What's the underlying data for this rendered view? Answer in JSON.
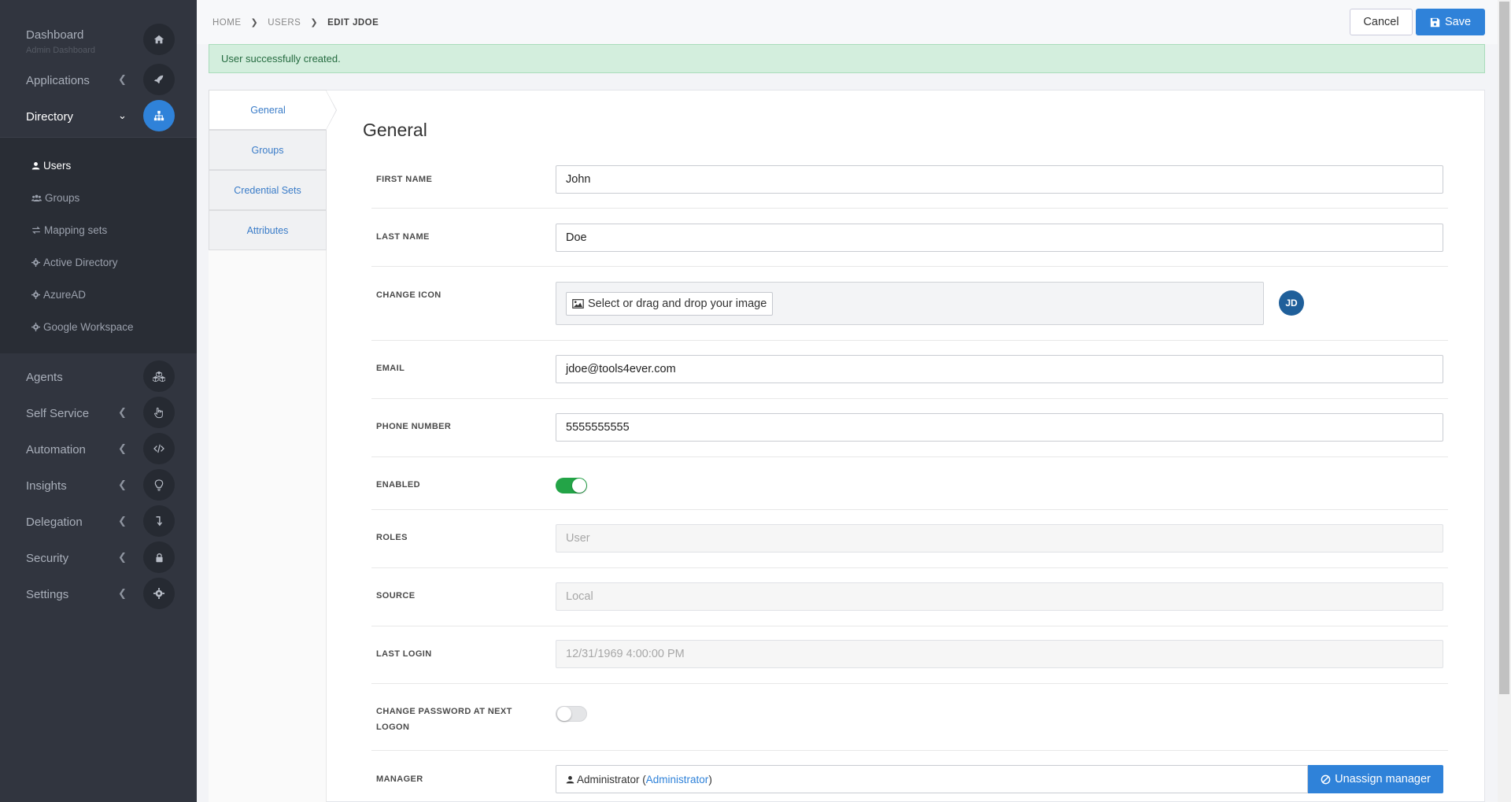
{
  "sidebar": {
    "dashboard": {
      "label": "Dashboard",
      "sublabel": "Admin Dashboard"
    },
    "applications": {
      "label": "Applications"
    },
    "directory": {
      "label": "Directory"
    },
    "directory_items": [
      {
        "label": "Users"
      },
      {
        "label": "Groups"
      },
      {
        "label": "Mapping sets"
      },
      {
        "label": "Active Directory"
      },
      {
        "label": "AzureAD"
      },
      {
        "label": "Google Workspace"
      }
    ],
    "agents": {
      "label": "Agents"
    },
    "self_service": {
      "label": "Self Service"
    },
    "automation": {
      "label": "Automation"
    },
    "insights": {
      "label": "Insights"
    },
    "delegation": {
      "label": "Delegation"
    },
    "security": {
      "label": "Security"
    },
    "settings": {
      "label": "Settings"
    }
  },
  "breadcrumb": [
    "HOME",
    "USERS",
    "EDIT JDOE"
  ],
  "toolbar": {
    "cancel_label": "Cancel",
    "save_label": "Save"
  },
  "alert": {
    "message": "User successfully created."
  },
  "tabs": [
    "General",
    "Groups",
    "Credential Sets",
    "Attributes"
  ],
  "form": {
    "title": "General",
    "first_name": {
      "label": "FIRST NAME",
      "value": "John"
    },
    "last_name": {
      "label": "LAST NAME",
      "value": "Doe"
    },
    "change_icon": {
      "label": "CHANGE ICON",
      "button": "Select or drag and drop your image",
      "avatar_initials": "JD"
    },
    "email": {
      "label": "EMAIL",
      "value": "jdoe@tools4ever.com"
    },
    "phone": {
      "label": "PHONE NUMBER",
      "value": "5555555555"
    },
    "enabled": {
      "label": "ENABLED",
      "on": true
    },
    "roles": {
      "label": "ROLES",
      "value": "User"
    },
    "source": {
      "label": "SOURCE",
      "value": "Local"
    },
    "last_login": {
      "label": "LAST LOGIN",
      "value": "12/31/1969 4:00:00 PM"
    },
    "change_password": {
      "label_line1": "CHANGE PASSWORD AT NEXT",
      "label_line2": "LOGON",
      "on": false
    },
    "manager": {
      "label": "MANAGER",
      "name": "Administrator",
      "link": "Administrator",
      "unassign_label": "Unassign manager"
    }
  },
  "colors": {
    "accent": "#2f82d9",
    "sidebar_bg": "#31353f",
    "success_bg": "#d3eedd",
    "toggle_on": "#23a447"
  }
}
